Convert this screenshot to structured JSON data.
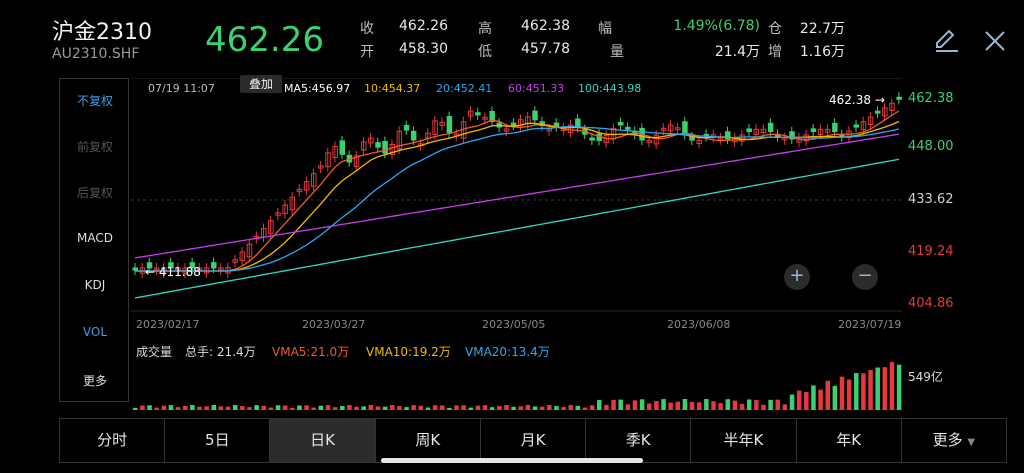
{
  "header": {
    "title": "沪金2310",
    "code": "AU2310.SHF",
    "price": "462.26",
    "stats": [
      {
        "label": "收",
        "value": "462.26"
      },
      {
        "label": "高",
        "value": "462.38"
      },
      {
        "label": "幅",
        "value": "1.49%(6.78)"
      },
      {
        "label": "仓",
        "value": "22.7万"
      },
      {
        "label": "开",
        "value": "458.30"
      },
      {
        "label": "低",
        "value": "457.78"
      },
      {
        "label": "量",
        "value": "21.4万"
      },
      {
        "label": "增",
        "value": "1.16万"
      }
    ],
    "edit_icon": "pencil-icon",
    "close_icon": "close-icon"
  },
  "side": {
    "items": [
      "不复权",
      "前复权",
      "后复权",
      "MACD",
      "KDJ",
      "VOL",
      "更多"
    ]
  },
  "chart": {
    "datetime": "07/19 11:07",
    "overlay_tag": "叠加",
    "ma": [
      {
        "label": "MA5:456.97",
        "color": "#ffffff"
      },
      {
        "label": "10:454.37",
        "color": "#f5b800"
      },
      {
        "label": "20:452.41",
        "color": "#2aa8f5"
      },
      {
        "label": "60:451.33",
        "color": "#c83cf0"
      },
      {
        "label": "100:443.98",
        "color": "#30d9c0"
      }
    ],
    "high_marker": "462.38",
    "low_marker": "411.88",
    "axis_right": [
      {
        "label": "462.38",
        "color": "#3bd16f"
      },
      {
        "label": "448.00",
        "color": "#3bd16f"
      },
      {
        "label": "433.62",
        "color": "#cfcfcf"
      },
      {
        "label": "419.24",
        "color": "#e5393a"
      },
      {
        "label": "404.86",
        "color": "#e5393a"
      }
    ],
    "dates": [
      "2023/02/17",
      "2023/03/27",
      "2023/05/05",
      "2023/06/08",
      "2023/07/19"
    ],
    "volume": {
      "label": "成交量",
      "total": "总手: 21.4万",
      "vma5": "VMA5:21.0万",
      "vma10": "VMA10:19.2万",
      "vma20": "VMA20:13.4万",
      "axis_label": "549亿"
    },
    "colors": {
      "up": "#e5393a",
      "down": "#3bd16f"
    }
  },
  "tabs": [
    "分时",
    "5日",
    "日K",
    "周K",
    "月K",
    "季K",
    "半年K",
    "年K",
    "更多"
  ],
  "active_tab": "日K"
}
